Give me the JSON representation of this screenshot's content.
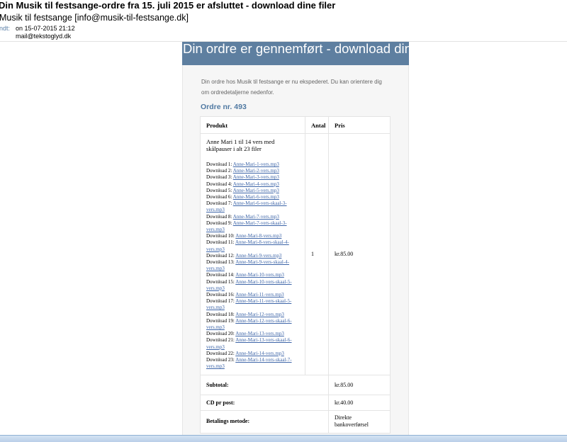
{
  "email": {
    "subject": "Din Musik til festsange-ordre fra 15. juli 2015 er afsluttet - download dine filer",
    "sender": "Musik til festsange [info@musik-til-festsange.dk]",
    "sent_label": "endt:",
    "sent_value": "on 15-07-2015 21:12",
    "to_label": ":",
    "to_value": "mail@tekstoglyd.dk"
  },
  "body": {
    "banner": "Din ordre er gennemført - download dine filer.",
    "intro": "Din ordre hos Musik til festsange er nu ekspederet. Du kan orientere dig om ordredetaljerne nedenfor.",
    "order_heading": "Ordre nr. 493"
  },
  "table": {
    "headers": {
      "product": "Produkt",
      "qty": "Antal",
      "price": "Pris"
    },
    "product_name": "Anne Mari 1 til 14 vers med skålpauser i alt 23 filer",
    "qty": "1",
    "price": "kr.85.00",
    "downloads": [
      {
        "label": "Download 1:",
        "file": "Anne-Mari-1-vers.mp3"
      },
      {
        "label": "Download 2:",
        "file": "Anne-Mari-2-vers.mp3"
      },
      {
        "label": "Download 3:",
        "file": "Anne-Mari-3-vers.mp3"
      },
      {
        "label": "Download 4:",
        "file": "Anne-Mari-4-vers.mp3"
      },
      {
        "label": "Download 5:",
        "file": "Anne-Mari-5-vers.mp3"
      },
      {
        "label": "Download 6:",
        "file": "Anne-Mari-6-vers.mp3"
      },
      {
        "label": "Download 7:",
        "file": "Anne-Mari-6-vers-skaal-3-vers.mp3"
      },
      {
        "label": "Download 8:",
        "file": "Anne-Mari-7-vers.mp3"
      },
      {
        "label": "Download 9:",
        "file": "Anne-Mari-7-vers-skaal-3-vers.mp3"
      },
      {
        "label": "Download 10:",
        "file": "Anne-Mari-8-vers.mp3"
      },
      {
        "label": "Download 11:",
        "file": "Anne-Mari-8-vers-skaal-4-vers.mp3"
      },
      {
        "label": "Download 12:",
        "file": "Anne-Mari-9-vers.mp3"
      },
      {
        "label": "Download 13:",
        "file": "Anne-Mari-9-vers-skaal-4-vers.mp3"
      },
      {
        "label": "Download 14:",
        "file": "Anne-Mari-10-vers.mp3"
      },
      {
        "label": "Download 15:",
        "file": "Anne-Mari-10-vers-skaal-5-vers.mp3"
      },
      {
        "label": "Download 16:",
        "file": "Anne-Mari-11-vers.mp3"
      },
      {
        "label": "Download 17:",
        "file": "Anne-Mari-11-vers-skaal-5-vers.mp3"
      },
      {
        "label": "Download 18:",
        "file": "Anne-Mari-12-vers.mp3"
      },
      {
        "label": "Download 19:",
        "file": "Anne-Mari-12-vers-skaal-6-vers.mp3"
      },
      {
        "label": "Download 20:",
        "file": "Anne-Mari-13-vers.mp3"
      },
      {
        "label": "Download 21:",
        "file": "Anne-Mari-13-vers-skaal-6-vers.mp3"
      },
      {
        "label": "Download 22:",
        "file": "Anne-Mari-14-vers.mp3"
      },
      {
        "label": "Download 23:",
        "file": "Anne-Mari-14-vers-skaal-7-vers.mp3"
      }
    ],
    "subtotal_label": "Subtotal:",
    "subtotal_value": "kr.85.00",
    "shipping_label": "CD pr post:",
    "shipping_value": "kr.40.00",
    "payment_label": "Betalings metode:",
    "payment_value": "Direkte bankoverførsel"
  },
  "colors": {
    "banner_bg": "#5e7fa0",
    "heading_blue": "#5079a2",
    "link_blue": "#3d65a8",
    "meta_label_blue": "#5a7fa8"
  }
}
